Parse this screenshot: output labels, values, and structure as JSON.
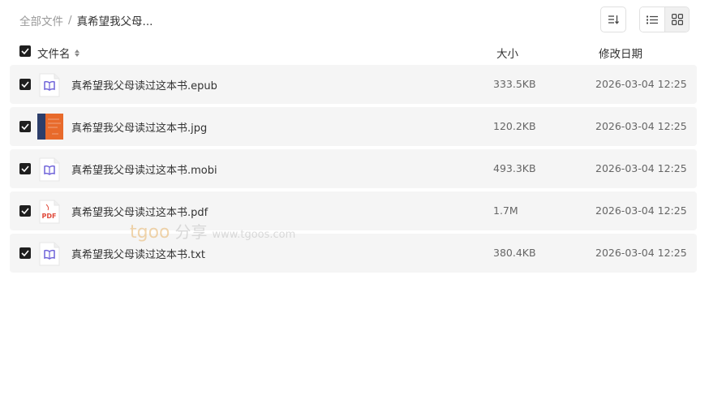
{
  "breadcrumb": {
    "root": "全部文件",
    "separator": "/",
    "current": "真希望我父母..."
  },
  "toolbar": {
    "sort_icon": "sort-icon",
    "list_view_icon": "list-view-icon",
    "grid_view_icon": "grid-view-icon"
  },
  "header": {
    "name": "文件名",
    "size": "大小",
    "date": "修改日期"
  },
  "files": [
    {
      "name": "真希望我父母读过这本书.epub",
      "size": "333.5KB",
      "date": "2026-03-04 12:25",
      "icon": "book-icon",
      "checked": true
    },
    {
      "name": "真希望我父母读过这本书.jpg",
      "size": "120.2KB",
      "date": "2026-03-04 12:25",
      "icon": "image-thumbnail",
      "checked": true
    },
    {
      "name": "真希望我父母读过这本书.mobi",
      "size": "493.3KB",
      "date": "2026-03-04 12:25",
      "icon": "book-icon",
      "checked": true
    },
    {
      "name": "真希望我父母读过这本书.pdf",
      "size": "1.7M",
      "date": "2026-03-04 12:25",
      "icon": "pdf-icon",
      "checked": true
    },
    {
      "name": "真希望我父母读过这本书.txt",
      "size": "380.4KB",
      "date": "2026-03-04 12:25",
      "icon": "book-icon",
      "checked": true
    }
  ],
  "watermark": {
    "logo": "tgoo",
    "cn": "分享",
    "url": "www.tgoos.com"
  },
  "colors": {
    "row_bg": "#f5f5f5",
    "checkbox": "#1f1f1f",
    "book_icon": "#6f63d9",
    "pdf_icon": "#e04b3c",
    "thumb": "#e86a2b"
  }
}
